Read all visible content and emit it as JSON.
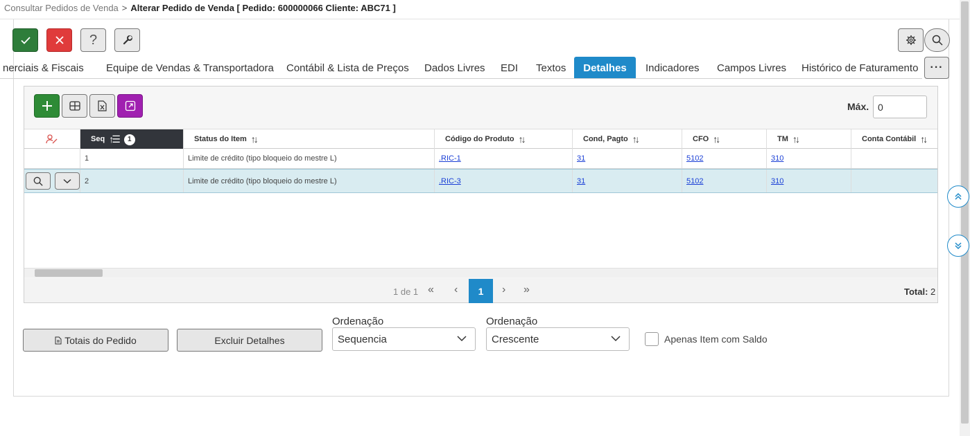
{
  "breadcrumb": {
    "parent": "Consultar Pedidos de Venda",
    "separator": ">",
    "current": "Alterar Pedido de Venda [ Pedido: 600000066 Cliente: ABC71 ]"
  },
  "toolbar": {
    "confirm_icon": "check-icon",
    "cancel_icon": "close-icon",
    "help_label": "?",
    "tools_icon": "wrench-icon",
    "settings_icon": "gear-icon",
    "search_icon": "search-icon"
  },
  "tabs": [
    {
      "label": "nerciais & Fiscais"
    },
    {
      "label": "Equipe de Vendas & Transportadora"
    },
    {
      "label": "Contábil & Lista de Preços"
    },
    {
      "label": "Dados Livres"
    },
    {
      "label": "EDI"
    },
    {
      "label": "Textos"
    },
    {
      "label": "Detalhes",
      "active": true
    },
    {
      "label": "Indicadores"
    },
    {
      "label": "Campos Livres"
    },
    {
      "label": "Histórico de Faturamento"
    }
  ],
  "tabs_more": "···",
  "grid": {
    "max_label": "Máx.",
    "max_value": "0",
    "columns": [
      {
        "label": ""
      },
      {
        "label": "Seq",
        "sort_badge": "1"
      },
      {
        "label": "Status do Item"
      },
      {
        "label": "Código do Produto"
      },
      {
        "label": "Cond, Pagto"
      },
      {
        "label": "CFO"
      },
      {
        "label": "TM"
      },
      {
        "label": "Conta Contábil"
      }
    ],
    "rows": [
      {
        "seq": "1",
        "status": "Limite de crédito (tipo bloqueio do mestre L)",
        "produto": ".RIC-1",
        "cond": "31",
        "cfo": "5102",
        "tm": "310",
        "conta": ""
      },
      {
        "seq": "2",
        "status": "Limite de crédito (tipo bloqueio do mestre L)",
        "produto": ".RIC-3",
        "cond": "31",
        "cfo": "5102",
        "tm": "310",
        "conta": ""
      }
    ],
    "pager": {
      "info": "1 de 1",
      "first": "«",
      "prev": "‹",
      "current": "1",
      "next": "›",
      "last": "»",
      "total_label": "Total:",
      "total_value": "2"
    }
  },
  "bottom": {
    "totais_label": "Totais do Pedido",
    "excluir_label": "Excluir Detalhes",
    "ordenacao1_label": "Ordenação",
    "ordenacao1_value": "Sequencia",
    "ordenacao2_label": "Ordenação",
    "ordenacao2_value": "Crescente",
    "checkbox_label": "Apenas Item com Saldo"
  },
  "colors": {
    "accent": "#1f8ac9",
    "confirm": "#2e7d3a",
    "cancel": "#e03b3b",
    "export": "#a020b0",
    "selected_row": "#d9ecf1"
  }
}
